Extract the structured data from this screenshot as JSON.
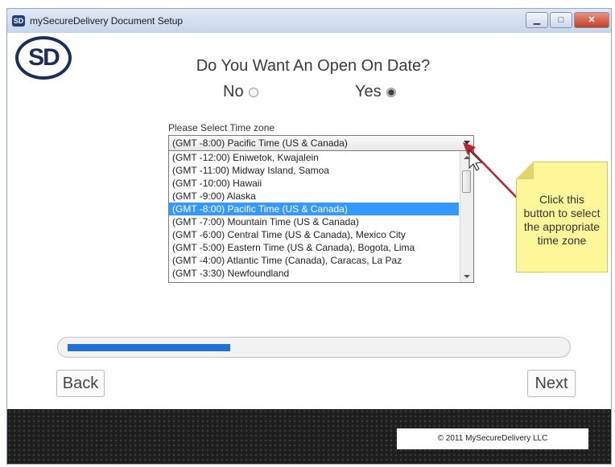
{
  "window": {
    "title": "mySecureDelivery Document Setup",
    "app_icon_text": "SD",
    "controls": {
      "minimize": "▁",
      "maximize": "□",
      "close": "✕"
    }
  },
  "logo": {
    "text": "SD"
  },
  "question": {
    "text": "Do You Want An Open On Date?",
    "options": [
      {
        "label": "No",
        "selected": false
      },
      {
        "label": "Yes",
        "selected": true
      }
    ]
  },
  "timezone": {
    "label": "Please Select Time zone",
    "selected_value": "(GMT -8:00) Pacific Time (US & Canada)",
    "options": [
      "(GMT -12:00) Eniwetok, Kwajalein",
      "(GMT -11:00) Midway Island, Samoa",
      "(GMT -10:00) Hawaii",
      "(GMT -9:00) Alaska",
      "(GMT -8:00) Pacific Time (US & Canada)",
      "(GMT -7:00) Mountain Time (US & Canada)",
      "(GMT -6:00) Central Time (US & Canada), Mexico City",
      "(GMT -5:00) Eastern Time (US & Canada), Bogota, Lima",
      "(GMT -4:00) Atlantic Time (Canada), Caracas, La Paz",
      "(GMT -3:30) Newfoundland"
    ],
    "highlighted_index": 4
  },
  "callout": {
    "text": "Click this button to select the appropriate time zone",
    "color": "#fff69a",
    "arrow_color": "#c0202a"
  },
  "progress": {
    "fraction": 0.33,
    "color": "#1f6fd8"
  },
  "nav": {
    "back_label": "Back",
    "next_label": "Next"
  },
  "footer": {
    "copyright": "© 2011 MySecureDelivery LLC"
  }
}
